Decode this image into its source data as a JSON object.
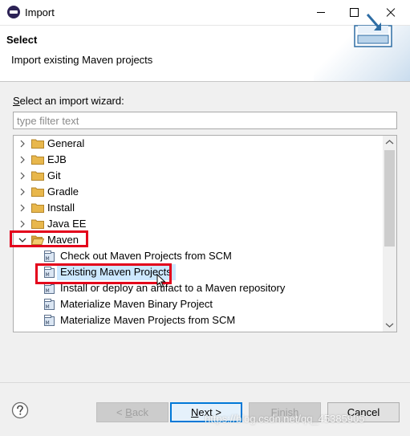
{
  "window": {
    "title": "Import"
  },
  "header": {
    "title": "Select",
    "description": "Import existing Maven projects"
  },
  "filter": {
    "label_prefix": "",
    "label_mnemonic": "S",
    "label_rest": "elect an import wizard:",
    "placeholder": "type filter text",
    "value": ""
  },
  "tree": {
    "folders": [
      {
        "label": "General",
        "expanded": false
      },
      {
        "label": "EJB",
        "expanded": false
      },
      {
        "label": "Git",
        "expanded": false
      },
      {
        "label": "Gradle",
        "expanded": false
      },
      {
        "label": "Install",
        "expanded": false
      },
      {
        "label": "Java EE",
        "expanded": false
      },
      {
        "label": "Maven",
        "expanded": true
      }
    ],
    "maven_children": [
      {
        "label": "Check out Maven Projects from SCM",
        "selected": false
      },
      {
        "label": "Existing Maven Projects",
        "selected": true
      },
      {
        "label": "Install or deploy an artifact to a Maven repository",
        "selected": false
      },
      {
        "label": "Materialize Maven Binary Project",
        "selected": false
      },
      {
        "label": "Materialize Maven Projects from SCM",
        "selected": false
      }
    ]
  },
  "buttons": {
    "back_mnemonic": "< ",
    "back_underline": "B",
    "back_rest": "ack",
    "next_underline": "N",
    "next_rest": "ext >",
    "finish_underline": "F",
    "finish_rest": "inish",
    "cancel": "Cancel"
  },
  "watermark": "https://blog.csdn.net/qq_45385905",
  "colors": {
    "highlight": "#e3001b",
    "selection": "#cce8ff",
    "folder": "#e8b74c",
    "default_button_border": "#0078d7"
  }
}
